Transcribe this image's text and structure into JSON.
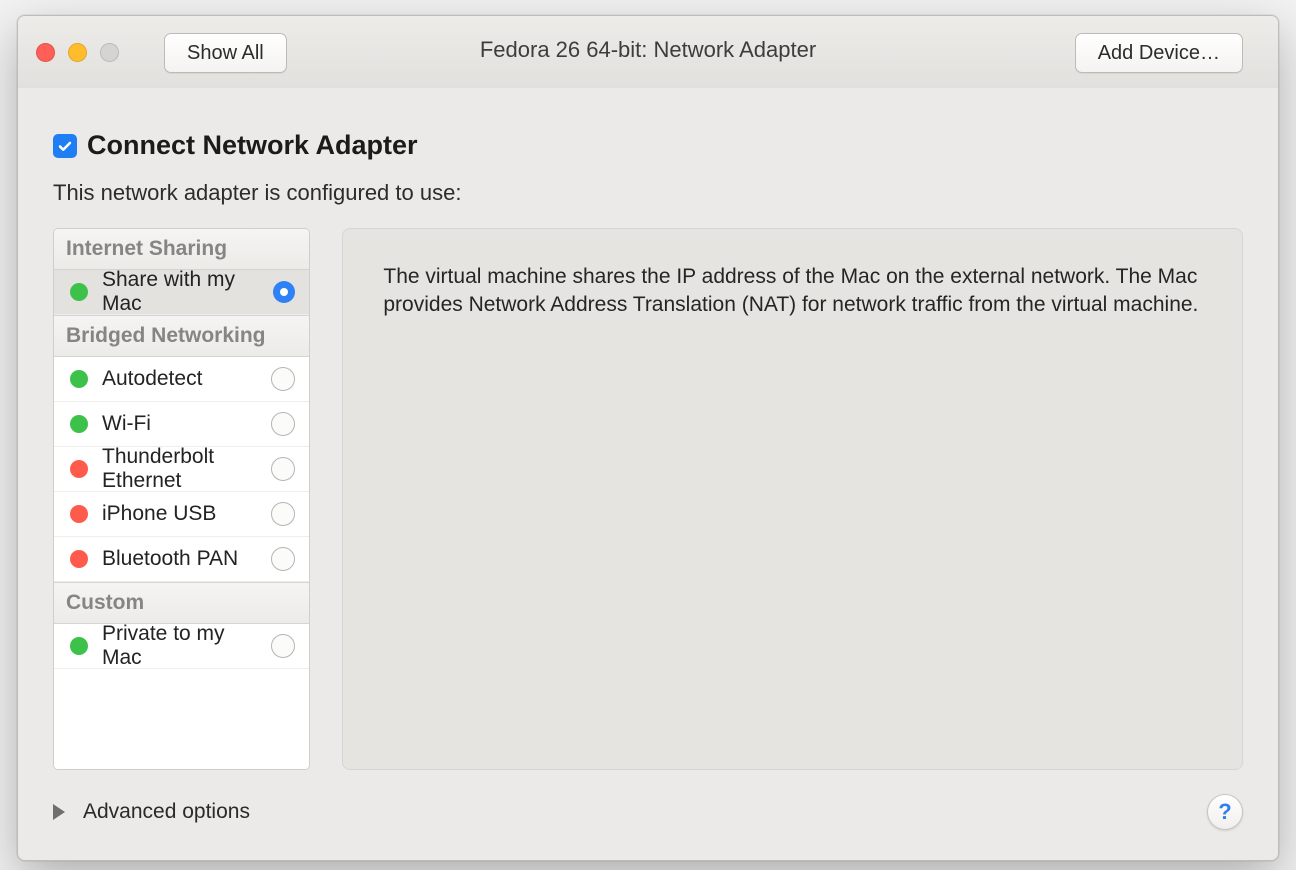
{
  "window": {
    "title": "Fedora 26 64-bit: Network Adapter",
    "show_all": "Show All",
    "add_device": "Add Device…"
  },
  "connect": {
    "checked": true,
    "label": "Connect Network Adapter"
  },
  "subtitle": "This network adapter is configured to use:",
  "sections": [
    {
      "header": "Internet Sharing",
      "items": [
        {
          "label": "Share with my Mac",
          "status": "green",
          "selected": true
        }
      ]
    },
    {
      "header": "Bridged Networking",
      "items": [
        {
          "label": "Autodetect",
          "status": "green",
          "selected": false
        },
        {
          "label": "Wi-Fi",
          "status": "green",
          "selected": false
        },
        {
          "label": "Thunderbolt Ethernet",
          "status": "red",
          "selected": false
        },
        {
          "label": "iPhone USB",
          "status": "red",
          "selected": false
        },
        {
          "label": "Bluetooth PAN",
          "status": "red",
          "selected": false
        }
      ]
    },
    {
      "header": "Custom",
      "items": [
        {
          "label": "Private to my Mac",
          "status": "green",
          "selected": false
        }
      ]
    }
  ],
  "description": "The virtual machine shares the IP address of the Mac on the external network. The Mac provides Network Address Translation (NAT) for network traffic from the virtual machine.",
  "footer": {
    "advanced": "Advanced options",
    "help": "?"
  }
}
